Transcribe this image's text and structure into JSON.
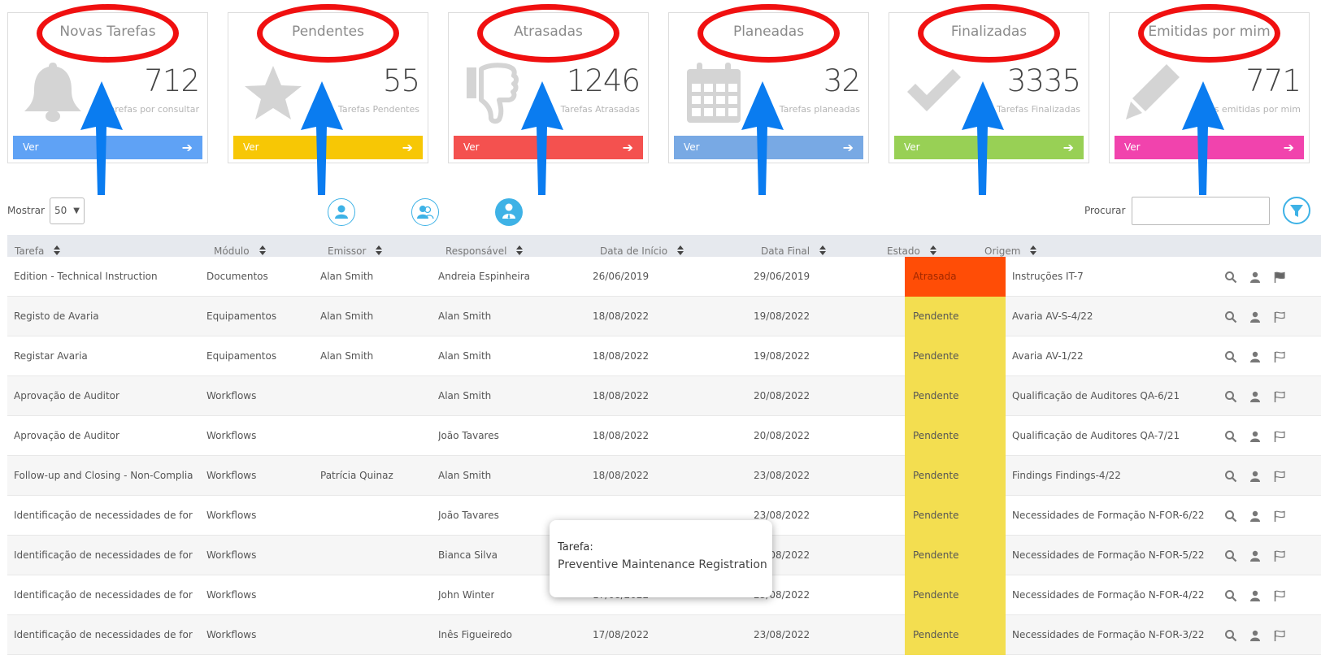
{
  "cards": [
    {
      "title": "Novas Tarefas",
      "value": "712",
      "subtitle": "Tarefas por consultar",
      "button": "Ver",
      "color": "#5fa2f5",
      "icon": "bell-icon"
    },
    {
      "title": "Pendentes",
      "value": "55",
      "subtitle": "Tarefas Pendentes",
      "button": "Ver",
      "color": "#f7c705",
      "icon": "star-icon"
    },
    {
      "title": "Atrasadas",
      "value": "1246",
      "subtitle": "Tarefas Atrasadas",
      "button": "Ver",
      "color": "#f4514f",
      "icon": "thumbs-down-icon"
    },
    {
      "title": "Planeadas",
      "value": "32",
      "subtitle": "Tarefas planeadas",
      "button": "Ver",
      "color": "#78a9e4",
      "icon": "calendar-icon"
    },
    {
      "title": "Finalizadas",
      "value": "3335",
      "subtitle": "Tarefas Finalizadas",
      "button": "Ver",
      "color": "#98d055",
      "icon": "check-icon"
    },
    {
      "title": "Emitidas por mim",
      "value": "771",
      "subtitle": "as emitidas por mim",
      "button": "Ver",
      "color": "#f143ad",
      "icon": "pencil-icon"
    }
  ],
  "controls": {
    "show_label": "Mostrar",
    "show_value": "50",
    "search_label": "Procurar",
    "search_value": ""
  },
  "table": {
    "headers": [
      "Tarefa",
      "Módulo",
      "Emissor",
      "Responsável",
      "Data de Início",
      "Data Final",
      "Estado",
      "Origem"
    ],
    "rows": [
      {
        "tarefa": "Edition - Technical Instruction",
        "modulo": "Documentos",
        "emissor": "Alan Smith",
        "responsavel": "Andreia Espinheira",
        "inicio": "26/06/2019",
        "final": "29/06/2019",
        "estado": "Atrasada",
        "origem": "Instruções IT-7"
      },
      {
        "tarefa": "Registo de Avaria",
        "modulo": "Equipamentos",
        "emissor": "Alan Smith",
        "responsavel": "Alan Smith",
        "inicio": "18/08/2022",
        "final": "19/08/2022",
        "estado": "Pendente",
        "origem": "Avaria AV-S-4/22"
      },
      {
        "tarefa": "Registar Avaria",
        "modulo": "Equipamentos",
        "emissor": "Alan Smith",
        "responsavel": "Alan Smith",
        "inicio": "18/08/2022",
        "final": "19/08/2022",
        "estado": "Pendente",
        "origem": "Avaria AV-1/22"
      },
      {
        "tarefa": "Aprovação de Auditor",
        "modulo": "Workflows",
        "emissor": "",
        "responsavel": "Alan Smith",
        "inicio": "18/08/2022",
        "final": "20/08/2022",
        "estado": "Pendente",
        "origem": "Qualificação de Auditores QA-6/21"
      },
      {
        "tarefa": "Aprovação de Auditor",
        "modulo": "Workflows",
        "emissor": "",
        "responsavel": "João Tavares",
        "inicio": "18/08/2022",
        "final": "20/08/2022",
        "estado": "Pendente",
        "origem": "Qualificação de Auditores QA-7/21"
      },
      {
        "tarefa": "Follow-up and Closing - Non-Complia...",
        "modulo": "Workflows",
        "emissor": "Patrícia Quinaz",
        "responsavel": "Alan Smith",
        "inicio": "18/08/2022",
        "final": "23/08/2022",
        "estado": "Pendente",
        "origem": "Findings Findings-4/22"
      },
      {
        "tarefa": "Identificação de necessidades de form...",
        "modulo": "Workflows",
        "emissor": "",
        "responsavel": "João Tavares",
        "inicio": "",
        "final": "23/08/2022",
        "estado": "Pendente",
        "origem": "Necessidades de Formação N-FOR-6/22"
      },
      {
        "tarefa": "Identificação de necessidades de form...",
        "modulo": "Workflows",
        "emissor": "",
        "responsavel": "Bianca Silva",
        "inicio": "",
        "final": "23/08/2022",
        "estado": "Pendente",
        "origem": "Necessidades de Formação N-FOR-5/22"
      },
      {
        "tarefa": "Identificação de necessidades de form...",
        "modulo": "Workflows",
        "emissor": "",
        "responsavel": "John Winter",
        "inicio": "17/08/2022",
        "final": "23/08/2022",
        "estado": "Pendente",
        "origem": "Necessidades de Formação N-FOR-4/22"
      },
      {
        "tarefa": "Identificação de necessidades de form...",
        "modulo": "Workflows",
        "emissor": "",
        "responsavel": "Inês Figueiredo",
        "inicio": "17/08/2022",
        "final": "23/08/2022",
        "estado": "Pendente",
        "origem": "Necessidades de Formação N-FOR-3/22"
      }
    ]
  },
  "status_colors": {
    "Atrasada": "#ff4d06",
    "Pendente": "#f3de50"
  },
  "tooltip": {
    "label": "Tarefa:",
    "value": "Preventive Maintenance Registration"
  },
  "annotation_color": "#f01010",
  "arrow_color": "#0a7cf0"
}
